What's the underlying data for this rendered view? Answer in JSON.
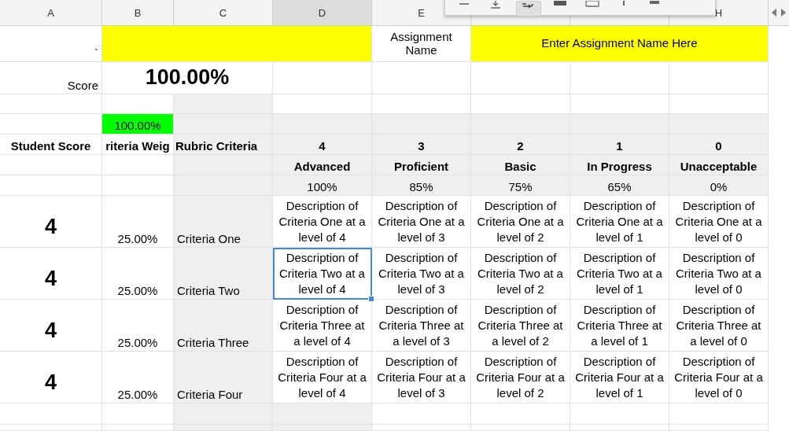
{
  "column_headers": [
    {
      "label": "A",
      "selected": false
    },
    {
      "label": "B",
      "selected": false
    },
    {
      "label": "C",
      "selected": false
    },
    {
      "label": "D",
      "selected": true
    },
    {
      "label": "E",
      "selected": false
    },
    {
      "label": "H",
      "selected": false
    }
  ],
  "toolbar": {
    "buttons": [
      {
        "kind": "align-middle",
        "selected": false
      },
      {
        "kind": "align-bottom",
        "selected": false
      },
      {
        "kind": "wrap",
        "selected": true
      },
      {
        "kind": "fill",
        "selected": false
      },
      {
        "kind": "borders",
        "selected": false
      },
      {
        "kind": "bar",
        "selected": false
      },
      {
        "kind": "minus",
        "selected": false
      }
    ]
  },
  "assignment": {
    "mark": "`",
    "label": "Assignment Name",
    "name": "Enter Assignment Name Here"
  },
  "score": {
    "label": "Score",
    "value": "100.00%"
  },
  "weight_total": "100.00%",
  "headers": [
    "Student Score",
    "riteria Weig",
    "Rubric Criteria"
  ],
  "levels": [
    {
      "points": "4",
      "name": "Advanced",
      "percent": "100%"
    },
    {
      "points": "3",
      "name": "Proficient",
      "percent": "85%"
    },
    {
      "points": "2",
      "name": "Basic",
      "percent": "75%"
    },
    {
      "points": "1",
      "name": "In Progress",
      "percent": "65%"
    },
    {
      "points": "0",
      "name": "Unacceptable",
      "percent": "0%"
    }
  ],
  "criteria": [
    {
      "student_score": "4",
      "weight": "25.00%",
      "name": "Criteria One",
      "descriptions": [
        {
          "text": "Description of Criteria One at a level of 4",
          "selected": false
        },
        {
          "text": "Description of Criteria One at a level of 3",
          "selected": false
        },
        {
          "text": "Description of Criteria One at a level of 2",
          "selected": false
        },
        {
          "text": "Description of Criteria One at a level of 1",
          "selected": false
        },
        {
          "text": "Description of Criteria One at a level of 0",
          "selected": false
        }
      ]
    },
    {
      "student_score": "4",
      "weight": "25.00%",
      "name": "Criteria Two",
      "descriptions": [
        {
          "text": "Description of Criteria Two at a level of 4",
          "selected": true
        },
        {
          "text": "Description of Criteria Two at a level of 3",
          "selected": false
        },
        {
          "text": "Description of Criteria Two at a level of 2",
          "selected": false
        },
        {
          "text": "Description of Criteria Two at a level of 1",
          "selected": false
        },
        {
          "text": "Description of Criteria Two at a level of 0",
          "selected": false
        }
      ]
    },
    {
      "student_score": "4",
      "weight": "25.00%",
      "name": "Criteria Three",
      "descriptions": [
        {
          "text": "Description of Criteria Three at a level of 4",
          "selected": false
        },
        {
          "text": "Description of Criteria Three at a level of 3",
          "selected": false
        },
        {
          "text": "Description of Criteria Three at a level of 2",
          "selected": false
        },
        {
          "text": "Description of Criteria Three at a level of 1",
          "selected": false
        },
        {
          "text": "Description of Criteria Three at a level of 0",
          "selected": false
        }
      ]
    },
    {
      "student_score": "4",
      "weight": "25.00%",
      "name": "Criteria Four",
      "descriptions": [
        {
          "text": "Description of Criteria Four at a level of 4",
          "selected": false
        },
        {
          "text": "Description of Criteria Four at a level of 3",
          "selected": false
        },
        {
          "text": "Description of Criteria Four at a level of 2",
          "selected": false
        },
        {
          "text": "Description of Criteria Four at a level of 1",
          "selected": false
        },
        {
          "text": "Description of Criteria Four at a level of 0",
          "selected": false
        }
      ]
    }
  ]
}
